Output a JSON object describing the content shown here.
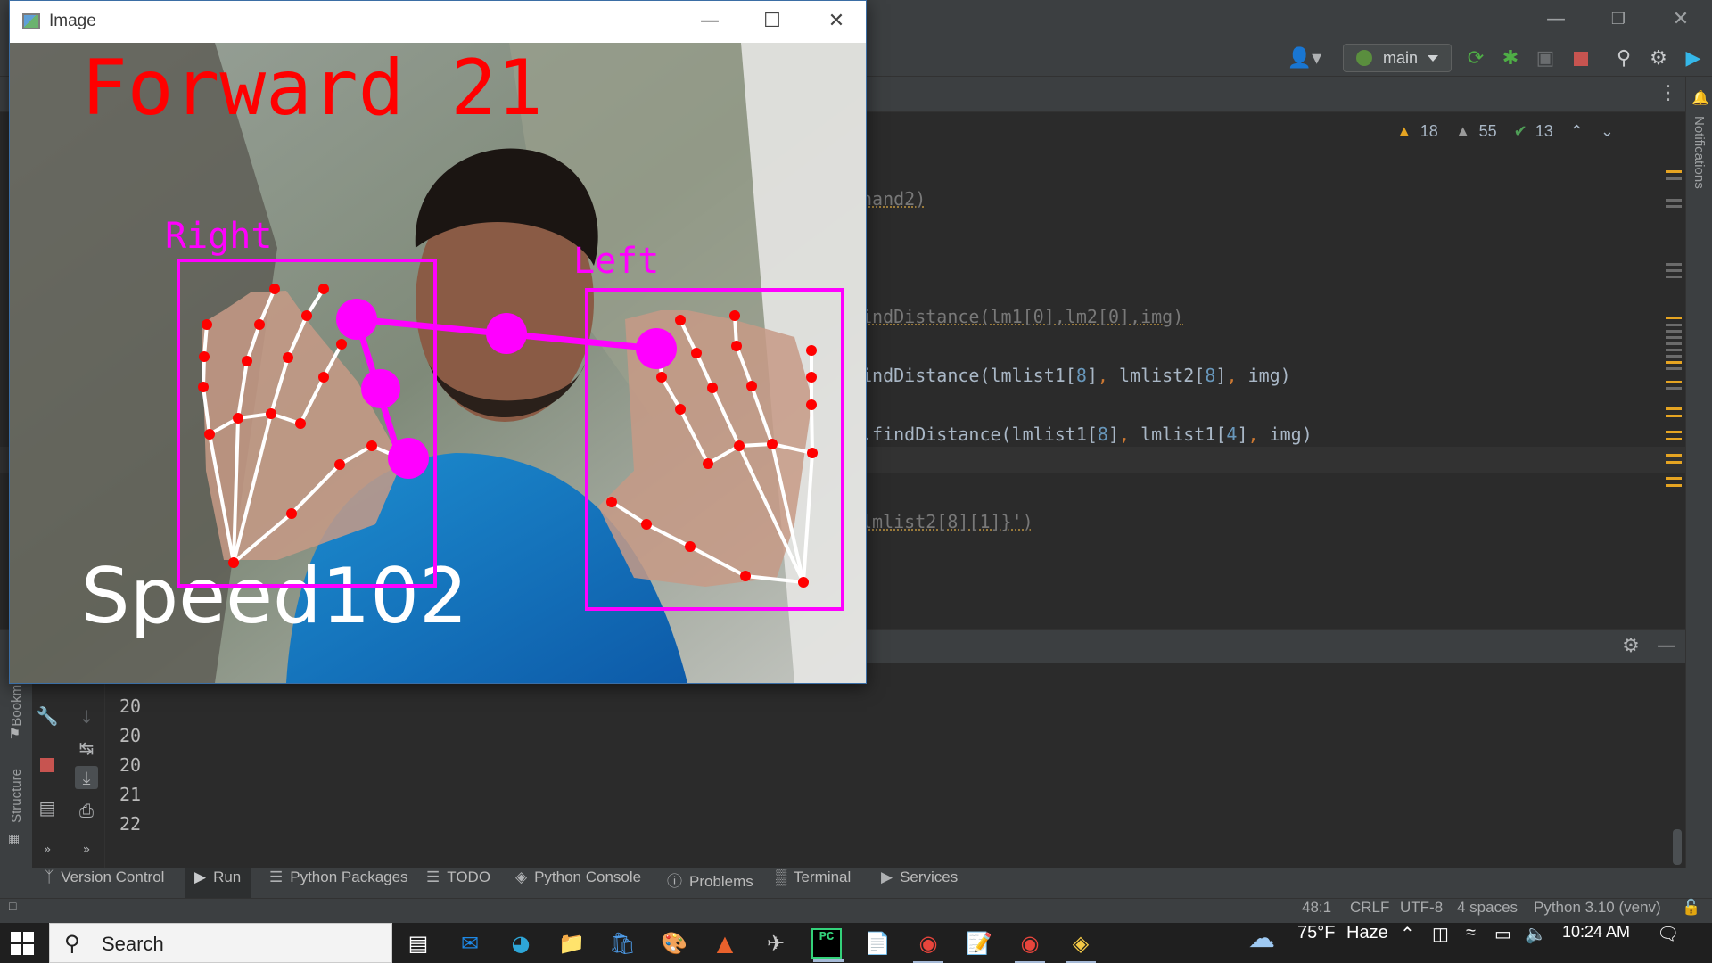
{
  "ide": {
    "branch": "main",
    "inspections": {
      "warnings": "18",
      "weak_warnings": "55",
      "typos": "13"
    },
    "notifications_label": "Notifications",
    "code_lines": {
      "l1": "hand2)",
      "l2": "indDistance(lm1[0],lm2[0],img)",
      "l3_a": "indDistance(lmlist1[",
      "l3_n1": "8",
      "l3_b": "]",
      "l3_c": ",",
      "l3_d": " lmlist2[",
      "l3_n2": "8",
      "l3_e": "]",
      "l3_f": ",",
      "l3_g": " img)",
      "l4_a": ".findDistance(lmlist1[",
      "l4_n1": "8",
      "l4_b": "]",
      "l4_c": ",",
      "l4_d": " lmlist1[",
      "l4_n2": "4",
      "l4_e": "]",
      "l4_f": ",",
      "l4_g": " img)",
      "l5": "lmlist2[8][1]}')"
    },
    "console_output": [
      "20",
      "20",
      "20",
      "21",
      "22"
    ],
    "side_labels": {
      "bookmarks": "Bookm",
      "structure": "Structure"
    },
    "tool_windows": [
      {
        "label": "Version Control",
        "icon": "branch-icon"
      },
      {
        "label": "Run",
        "icon": "run-icon"
      },
      {
        "label": "Python Packages",
        "icon": "layers-icon"
      },
      {
        "label": "TODO",
        "icon": "list-icon"
      },
      {
        "label": "Python Console",
        "icon": "python-icon"
      },
      {
        "label": "Problems",
        "icon": "info-icon"
      },
      {
        "label": "Terminal",
        "icon": "terminal-icon"
      },
      {
        "label": "Services",
        "icon": "services-icon"
      }
    ],
    "status": {
      "position": "48:1",
      "line_sep": "CRLF",
      "encoding": "UTF-8",
      "indent": "4 spaces",
      "interpreter": "Python 3.10 (venv)"
    }
  },
  "image_window": {
    "title": "Image",
    "overlay_top": "Forward 21",
    "overlay_bottom": "Speed102",
    "right_hand_label": "Right",
    "left_hand_label": "Left",
    "overlay_colors": {
      "command": "#ff0000",
      "hand": "#ff00ff",
      "landmark": "#ff0000",
      "skeleton": "#ffffff"
    }
  },
  "taskbar": {
    "search_placeholder": "Search",
    "weather_temp": "75°F",
    "weather_desc": "Haze",
    "time": "10:24 AM",
    "apps": [
      "task-view-icon",
      "mail-icon",
      "edge-icon",
      "file-explorer-icon",
      "store-icon",
      "paint-icon",
      "matlab-icon",
      "jet-icon",
      "pycharm-icon",
      "office-icon",
      "chrome-icon",
      "notepad-icon",
      "chrome-icon",
      "python-icon"
    ]
  }
}
